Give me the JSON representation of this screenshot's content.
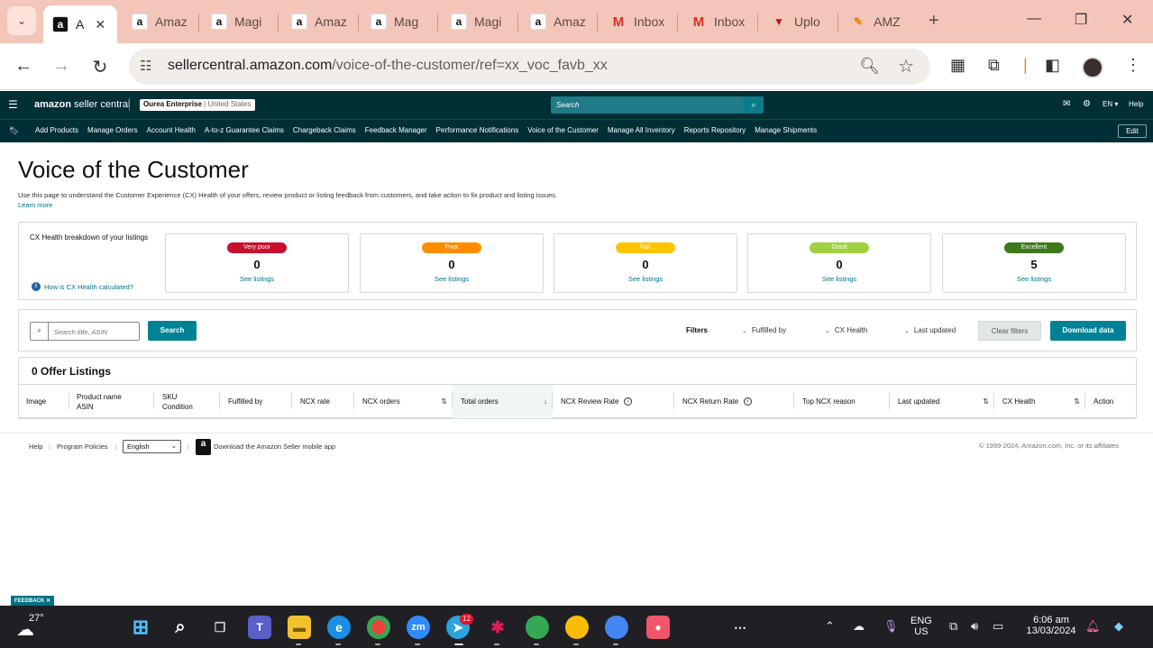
{
  "browser": {
    "tabs": [
      {
        "label": "A",
        "favicon": "a",
        "active": true
      },
      {
        "label": "Amaz",
        "favicon": "a"
      },
      {
        "label": "Magi",
        "favicon": "a"
      },
      {
        "label": "Amaz",
        "favicon": "a"
      },
      {
        "label": "Mag",
        "favicon": "a"
      },
      {
        "label": "Magi",
        "favicon": "a"
      },
      {
        "label": "Amaz",
        "favicon": "a"
      },
      {
        "label": "Inbox",
        "favicon": "M"
      },
      {
        "label": "Inbox",
        "favicon": "M"
      },
      {
        "label": "Uplo",
        "favicon": "▼"
      },
      {
        "label": "AMZ",
        "favicon": "✎"
      }
    ],
    "url_host": "sellercentral.amazon.com",
    "url_path": "/voice-of-the-customer/ref=xx_voc_favb_xx"
  },
  "header": {
    "logo_bold": "amazon",
    "logo_light": " seller central",
    "store_name": "Ourea Enterprise",
    "store_region": "United States",
    "search_placeholder": "Search",
    "lang": "EN",
    "help": "Help"
  },
  "nav": {
    "items": [
      "Add Products",
      "Manage Orders",
      "Account Health",
      "A-to-z Guarantee Claims",
      "Chargeback Claims",
      "Feedback Manager",
      "Performance Notifications",
      "Voice of the Customer",
      "Manage All Inventory",
      "Reports Repository",
      "Manage Shipments"
    ],
    "edit": "Edit"
  },
  "page": {
    "title": "Voice of the Customer",
    "description": "Use this page to understand the Customer Experience (CX) Health of your offers, review product or listing feedback from customers, and take action to fix product and listing issues.",
    "learn_more": "Learn more"
  },
  "cx": {
    "label": "CX Health breakdown of your listings",
    "how_link": "How is CX Health calculated?",
    "cards": [
      {
        "label": "Very poor",
        "count": "0",
        "link": "See listings",
        "color": "#c7102e"
      },
      {
        "label": "Poor",
        "count": "0",
        "link": "See listings",
        "color": "#ff8c00"
      },
      {
        "label": "Fair",
        "count": "0",
        "link": "See listings",
        "color": "#ffc400"
      },
      {
        "label": "Good",
        "count": "0",
        "link": "See listings",
        "color": "#9fd142"
      },
      {
        "label": "Excellent",
        "count": "5",
        "link": "See listings",
        "color": "#3d7a1c"
      }
    ]
  },
  "filters": {
    "search_placeholder": "Search title, ASIN",
    "search_button": "Search",
    "label": "Filters",
    "fulfilled_by": "Fulfilled by",
    "cx_health": "CX Health",
    "last_updated": "Last updated",
    "clear": "Clear filters",
    "download": "Download data"
  },
  "table": {
    "title": "0 Offer Listings",
    "columns": {
      "image": "Image",
      "product_line1": "Product name",
      "product_line2": "ASIN",
      "sku_line1": "SKU",
      "sku_line2": "Condition",
      "fulfilled_by": "Fulfilled by",
      "ncx_rate": "NCX rate",
      "ncx_orders": "NCX orders",
      "total_orders": "Total orders",
      "ncx_review_rate": "NCX Review Rate",
      "ncx_return_rate": "NCX Return Rate",
      "top_ncx_reason": "Top NCX reason",
      "last_updated": "Last updated",
      "cx_health": "CX Health",
      "action": "Action"
    }
  },
  "footer": {
    "help": "Help",
    "policies": "Program Policies",
    "language": "English",
    "app": "Download the Amazon Seller mobile app",
    "copyright": "© 1999-2024, Amazon.com, Inc. or its affiliates"
  },
  "feedback": "FEEDBACK",
  "taskbar": {
    "temp": "27°",
    "lang1": "ENG",
    "lang2": "US",
    "time": "6:06 am",
    "date": "13/03/2024",
    "badge": "12"
  }
}
